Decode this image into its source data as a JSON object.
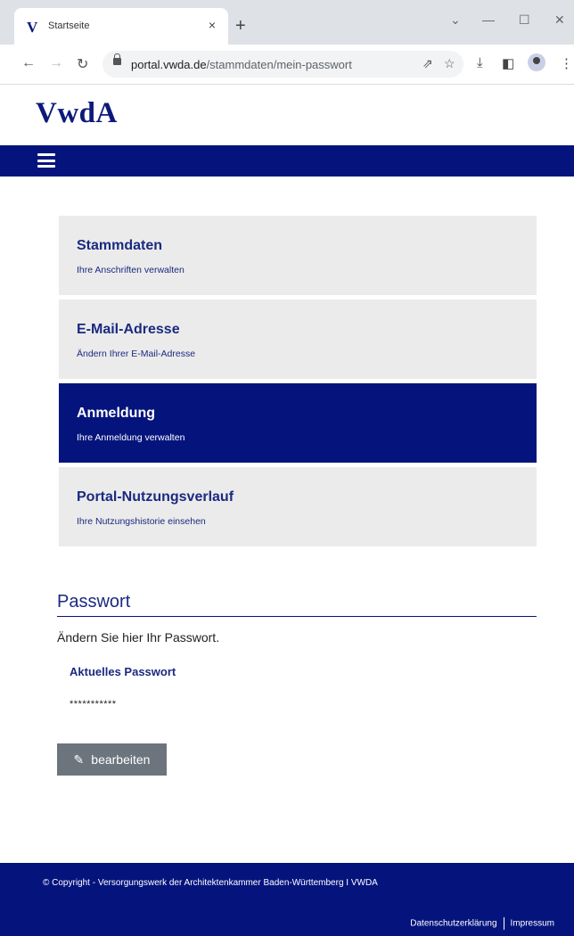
{
  "browser": {
    "tab_title": "Startseite",
    "tab_favicon": "V",
    "tab_close": "×",
    "new_tab": "+",
    "url_host": "portal.vwda.de",
    "url_path": "/stammdaten/mein-passwort",
    "icons": [
      "back-icon",
      "forward-icon",
      "reload-icon",
      "lock-icon",
      "share-icon",
      "star-icon",
      "download-icon",
      "sidepanel-icon",
      "profile-icon",
      "menu-icon"
    ]
  },
  "site": {
    "logo": "VwdA",
    "brand_color": "#05147d"
  },
  "cards": [
    {
      "title": "Stammdaten",
      "subtitle": "Ihre Anschriften verwalten",
      "active": false
    },
    {
      "title": "E-Mail-Adresse",
      "subtitle": "Ändern Ihrer E-Mail-Adresse",
      "active": false
    },
    {
      "title": "Anmeldung",
      "subtitle": "Ihre Anmeldung verwalten",
      "active": true
    },
    {
      "title": "Portal-Nutzungsverlauf",
      "subtitle": "Ihre Nutzungshistorie einsehen",
      "active": false
    }
  ],
  "password": {
    "section_title": "Passwort",
    "description": "Ändern Sie hier Ihr Passwort.",
    "field_label": "Aktuelles Passwort",
    "field_value": "***********",
    "edit_button": "bearbeiten"
  },
  "footer": {
    "copyright": "© Copyright - Versorgungswerk der Architektenkammer Baden-Württemberg I VWDA",
    "link_privacy": "Datenschutzerklärung",
    "link_imprint": "Impressum"
  }
}
